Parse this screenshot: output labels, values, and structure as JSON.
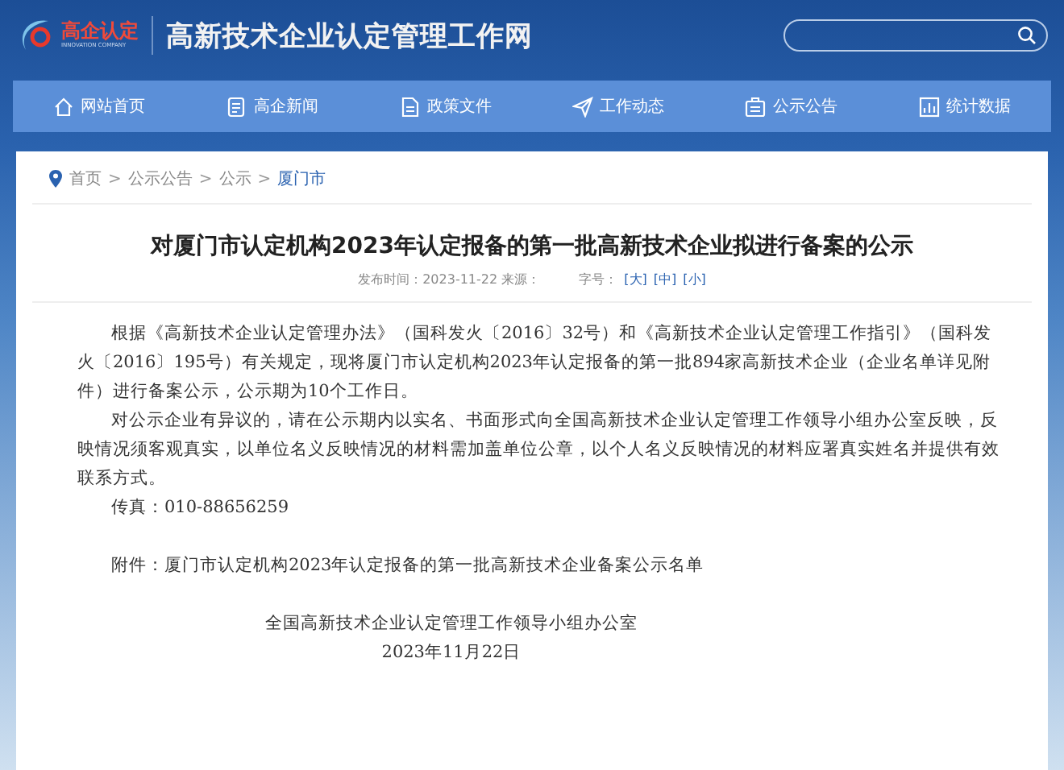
{
  "header": {
    "logo_text": "高企认定",
    "logo_subtext": "INNOVATION COMPANY",
    "site_title": "高新技术企业认定管理工作网"
  },
  "nav": [
    {
      "label": "网站首页",
      "kind": "home"
    },
    {
      "label": "高企新闻",
      "kind": "doc"
    },
    {
      "label": "政策文件",
      "kind": "file"
    },
    {
      "label": "工作动态",
      "kind": "plane"
    },
    {
      "label": "公示公告",
      "kind": "board"
    },
    {
      "label": "统计数据",
      "kind": "chart"
    }
  ],
  "breadcrumb": {
    "separator": ">",
    "items": [
      {
        "label": "首页",
        "selected": false
      },
      {
        "label": "公示公告",
        "selected": false
      },
      {
        "label": "公示",
        "selected": false
      },
      {
        "label": "厦门市",
        "selected": true
      }
    ]
  },
  "article": {
    "title": "对厦门市认定机构2023年认定报备的第一批高新技术企业拟进行备案的公示",
    "meta": "发布时间：2023-11-22 来源：",
    "font_size_label": "字号：",
    "font_sizes": [
      "[大]",
      "[中]",
      "[小]"
    ],
    "paragraphs": [
      "根据《高新技术企业认定管理办法》（国科发火〔2016〕32号）和《高新技术企业认定管理工作指引》（国科发火〔2016〕195号）有关规定，现将厦门市认定机构2023年认定报备的第一批894家高新技术企业（企业名单详见附件）进行备案公示，公示期为10个工作日。",
      "对公示企业有异议的，请在公示期内以实名、书面形式向全国高新技术企业认定管理工作领导小组办公室反映，反映情况须客观真实，以单位名义反映情况的材料需加盖单位公章，以个人名义反映情况的材料应署真实姓名并提供有效联系方式。",
      "传真：010-88656259"
    ],
    "attachment": "附件：厦门市认定机构2023年认定报备的第一批高新技术企业备案公示名单",
    "signature": "全国高新技术企业认定管理工作领导小组办公室",
    "date": "2023年11月22日"
  }
}
